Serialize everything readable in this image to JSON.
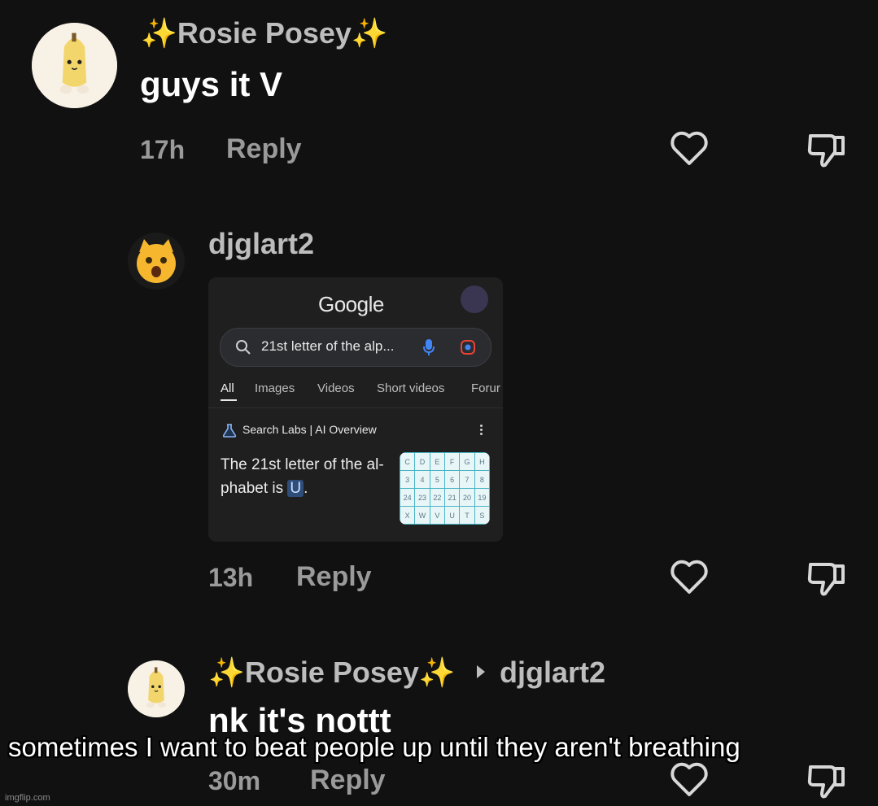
{
  "comments": [
    {
      "username": "✨Rosie Posey✨",
      "avatar_icon": "banana-cat-icon",
      "message": "guys it V",
      "time": "17h",
      "reply_label": "Reply"
    },
    {
      "username": "djglart2",
      "avatar_icon": "cat-face-icon",
      "time": "13h",
      "reply_label": "Reply",
      "embedded_screenshot": {
        "logo": "Google",
        "search_query": "21st letter of the alp...",
        "tabs": [
          "All",
          "Images",
          "Videos",
          "Short videos",
          "Forur"
        ],
        "active_tab": "All",
        "ai_overview_label": "Search Labs | AI Overview",
        "answer_line1": "The 21st letter of the al-",
        "answer_line2_prefix": "phabet is ",
        "answer_highlight": "U",
        "answer_line2_suffix": ".",
        "thumbnail_rows": [
          [
            "C",
            "D",
            "E",
            "F",
            "G",
            "H"
          ],
          [
            "3",
            "4",
            "5",
            "6",
            "7",
            "8"
          ],
          [
            "24",
            "23",
            "22",
            "21",
            "20",
            "19"
          ],
          [
            "X",
            "W",
            "V",
            "U",
            "T",
            "S"
          ]
        ]
      }
    },
    {
      "username": "✨Rosie Posey✨",
      "reply_to": "djglart2",
      "avatar_icon": "banana-cat-icon",
      "message": "nk it's nottt",
      "time": "30m",
      "reply_label": "Reply"
    }
  ],
  "caption": "sometimes I want to beat people up until they aren't breathing",
  "watermark": "imgflip.com",
  "colors": {
    "background": "#111111",
    "username": "#bdbdbd",
    "message": "#ffffff",
    "meta": "#9a9a9a"
  }
}
